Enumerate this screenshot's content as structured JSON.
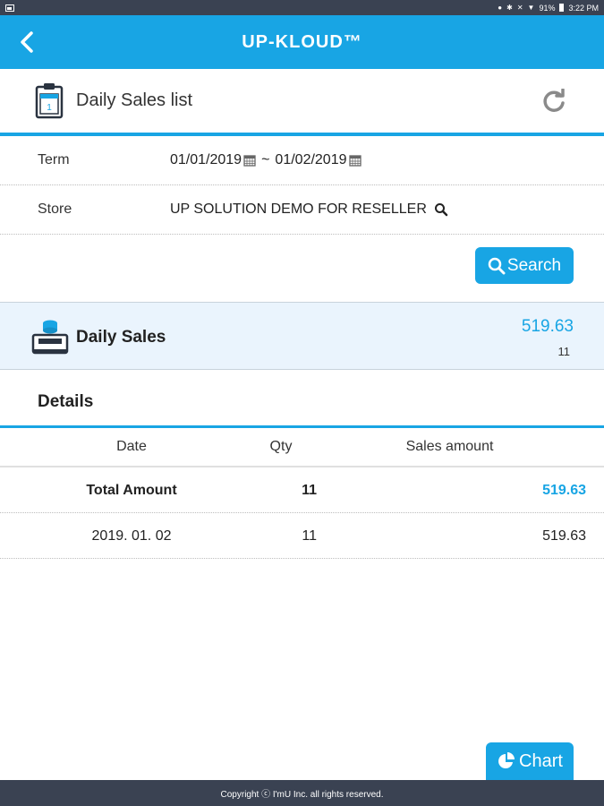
{
  "status_bar": {
    "battery": "91%",
    "time": "3:22 PM"
  },
  "header": {
    "title": "UP-KLOUD™"
  },
  "page": {
    "title": "Daily Sales list"
  },
  "form": {
    "term_label": "Term",
    "date_from": "01/01/2019",
    "date_separator": "~",
    "date_to": "01/02/2019",
    "store_label": "Store",
    "store_value": "UP SOLUTION DEMO FOR RESELLER",
    "search_label": "Search"
  },
  "summary": {
    "title": "Daily Sales",
    "amount": "519.63",
    "qty": "11"
  },
  "details": {
    "title": "Details",
    "columns": [
      "Date",
      "Qty",
      "Sales amount"
    ],
    "total": {
      "label": "Total Amount",
      "qty": "11",
      "amount": "519.63"
    },
    "rows": [
      {
        "date": "2019. 01. 02",
        "qty": "11",
        "amount": "519.63"
      }
    ]
  },
  "chart_button_label": "Chart",
  "footer": {
    "text": "Copyright ⓒ I'mU Inc. all rights reserved."
  },
  "colors": {
    "accent": "#18a5e4",
    "dark_bar": "#3a4252",
    "summary_bg": "#eaf4fd"
  }
}
